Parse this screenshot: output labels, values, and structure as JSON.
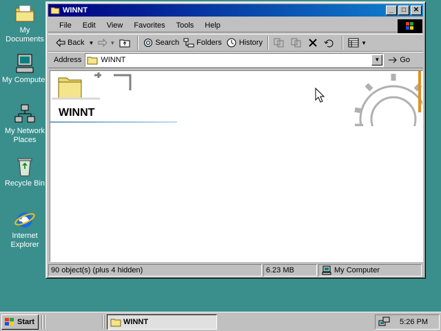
{
  "desktop": {
    "icons": [
      {
        "label": "My Documents",
        "icon": "folder-icon"
      },
      {
        "label": "My Computer",
        "icon": "computer-icon"
      },
      {
        "label": "My Network Places",
        "icon": "network-icon"
      },
      {
        "label": "Recycle Bin",
        "icon": "recycle-bin-icon"
      },
      {
        "label": "Internet Explorer",
        "icon": "ie-icon"
      }
    ]
  },
  "window": {
    "title": "WINNT",
    "menu": [
      "File",
      "Edit",
      "View",
      "Favorites",
      "Tools",
      "Help"
    ],
    "toolbar": {
      "back": "Back",
      "search": "Search",
      "folders": "Folders",
      "history": "History"
    },
    "address": {
      "label": "Address",
      "value": "WINNT",
      "go": "Go"
    },
    "content": {
      "folder_title": "WINNT"
    },
    "status": {
      "objects": "90 object(s) (plus 4 hidden)",
      "size": "6.23 MB",
      "zone": "My Computer"
    }
  },
  "taskbar": {
    "start": "Start",
    "task_label": "WINNT",
    "clock": "5:26 PM"
  },
  "colors": {
    "desktop": "#3a8e8c",
    "title_start": "#000080",
    "title_end": "#1084d0"
  }
}
